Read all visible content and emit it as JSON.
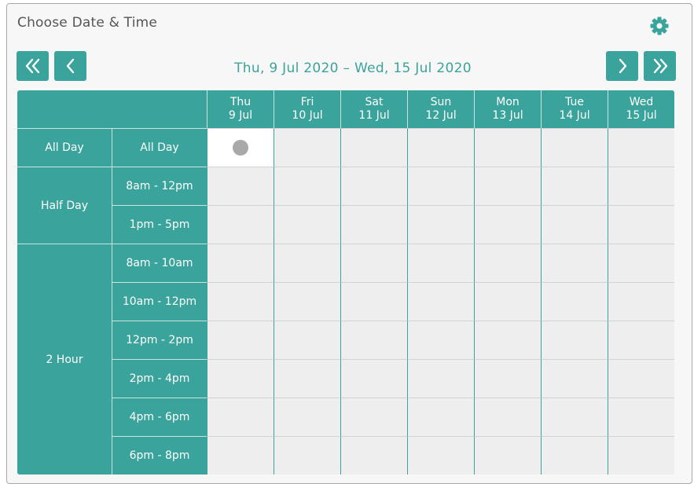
{
  "panel": {
    "title": "Choose Date & Time"
  },
  "icons": {
    "settings": "gear-icon",
    "first": "double-chevron-left-icon",
    "prev": "chevron-left-icon",
    "next": "chevron-right-icon",
    "last": "double-chevron-right-icon"
  },
  "colors": {
    "accent": "#3aa39c",
    "cell_bg": "#eeeeee",
    "selected_bg": "#ffffff",
    "marker": "#a9a9a9",
    "title_text": "#555555"
  },
  "date_range": "Thu, 9 Jul 2020 – Wed, 15 Jul 2020",
  "days": [
    {
      "weekday": "Thu",
      "date": "9 Jul"
    },
    {
      "weekday": "Fri",
      "date": "10 Jul"
    },
    {
      "weekday": "Sat",
      "date": "11 Jul"
    },
    {
      "weekday": "Sun",
      "date": "12 Jul"
    },
    {
      "weekday": "Mon",
      "date": "13 Jul"
    },
    {
      "weekday": "Tue",
      "date": "14 Jul"
    },
    {
      "weekday": "Wed",
      "date": "15 Jul"
    }
  ],
  "groups": [
    {
      "label": "All Day",
      "slots": [
        "All Day"
      ]
    },
    {
      "label": "Half Day",
      "slots": [
        "8am - 12pm",
        "1pm - 5pm"
      ]
    },
    {
      "label": "2 Hour",
      "slots": [
        "8am - 10am",
        "10am - 12pm",
        "12pm - 2pm",
        "2pm - 4pm",
        "4pm - 6pm",
        "6pm - 8pm"
      ]
    }
  ],
  "selected": {
    "slot_row": 0,
    "day_col": 0
  }
}
